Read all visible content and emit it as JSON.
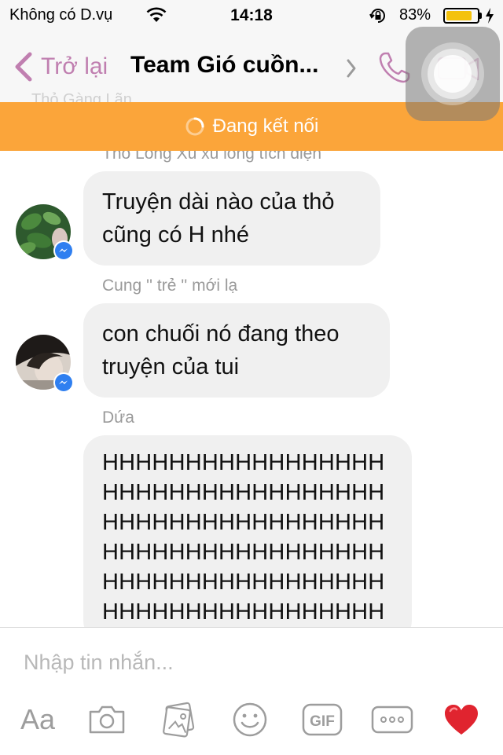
{
  "status": {
    "carrier": "Không có D.vụ",
    "time": "14:18",
    "battery_percent": "83%",
    "battery_level": 0.83
  },
  "nav": {
    "back_label": "Trở lại",
    "title": "Team Gió cuồn...",
    "ghost_sender": "Thỏ Gàng Lãn"
  },
  "banner": {
    "text": "Đang kết nối"
  },
  "messages": [
    {
      "sender": "Thỏ Long Xù xù long tích điện"
    },
    {
      "sender": "",
      "text_lines": [
        "Truyện dài nào của thỏ",
        "cũng có H nhé"
      ]
    },
    {
      "sender": "Cung '' trẻ '' mới lạ",
      "text_lines": [
        "con chuối nó đang theo",
        "truyện của tui"
      ]
    },
    {
      "sender": "Dứa",
      "text_lines": [
        "HHHHHHHHHHHHHHHHH",
        "HHHHHHHHHHHHHHHHH",
        "HHHHHHHHHHHHHHHHH",
        "HHHHHHHHHHHHHHHHH",
        "HHHHHHHHHHHHHHHHH",
        "HHHHHHHHHHHHHHHHH"
      ]
    }
  ],
  "composer": {
    "placeholder": "Nhập tin nhắn...",
    "aa_label": "Aa",
    "gif_label": "GIF"
  },
  "icons": {
    "wifi": "wifi-icon",
    "orientation_lock": "orientation-lock-icon",
    "charging": "charging-icon",
    "back": "chevron-left-icon",
    "title_chevron": "chevron-right-icon",
    "call": "phone-icon",
    "video": "video-camera-icon",
    "spinner": "spinner-icon",
    "messenger_badge": "messenger-icon",
    "camera": "camera-icon",
    "gallery": "gallery-icon",
    "emoji": "smiley-icon",
    "more": "more-icon",
    "heart": "heart-icon"
  },
  "colors": {
    "accent": "#c07fb0",
    "banner": "#fba53a",
    "bubble": "#f0f0f0",
    "battery": "#f4c20d",
    "messenger": "#2f7ff0",
    "heart": "#e0242f"
  }
}
